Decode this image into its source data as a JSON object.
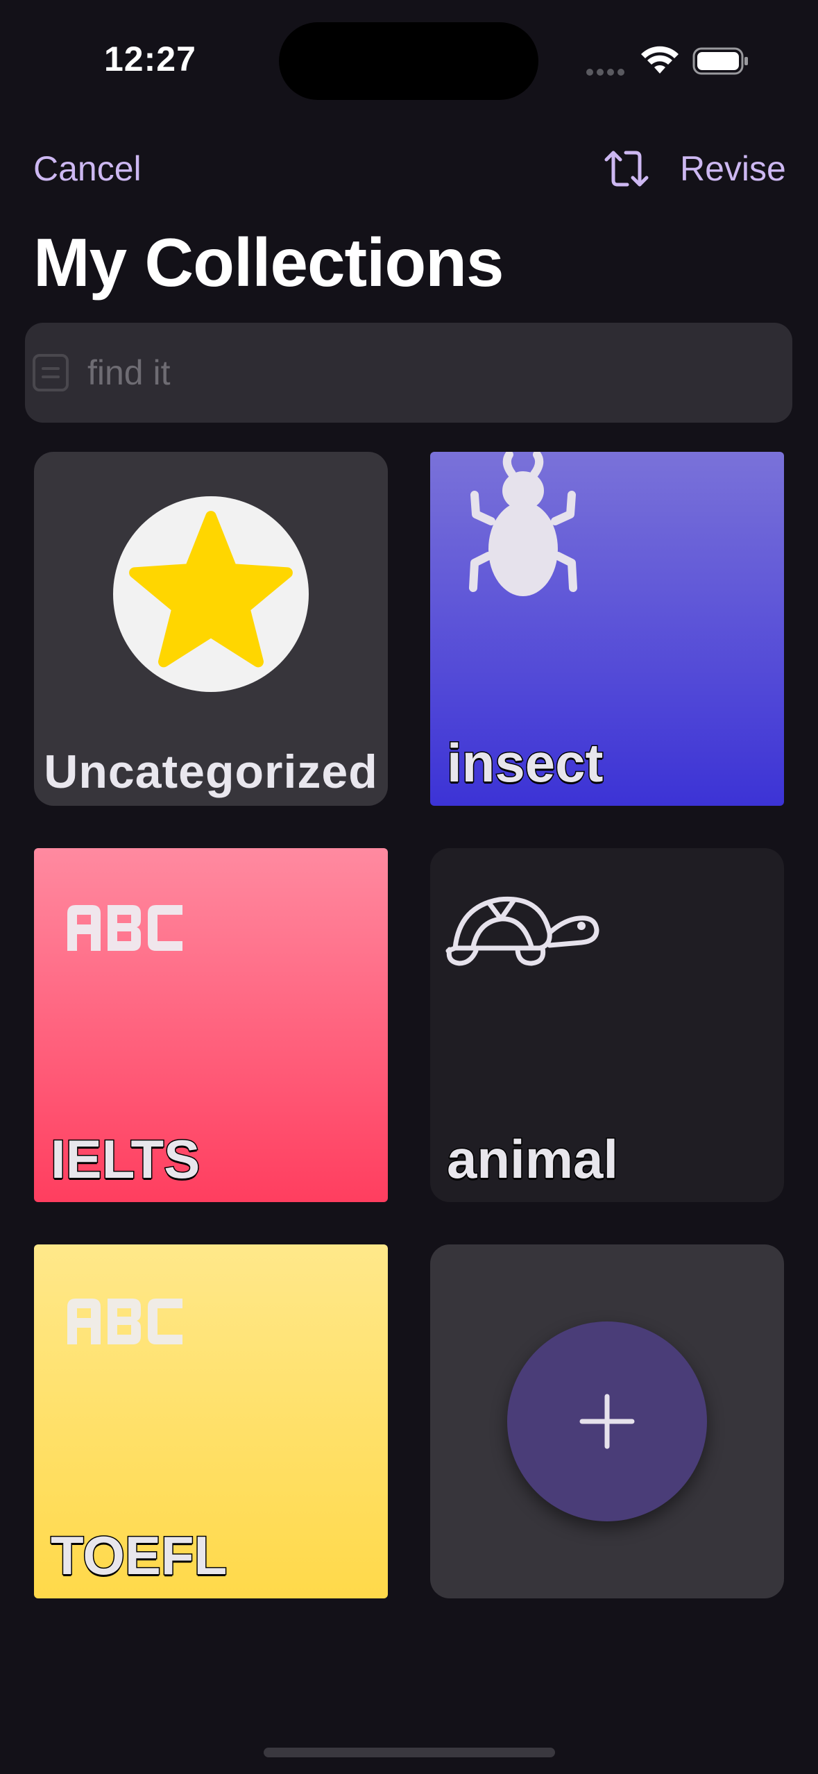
{
  "status_bar": {
    "time": "12:27"
  },
  "nav": {
    "cancel_label": "Cancel",
    "revise_label": "Revise"
  },
  "page": {
    "title": "My Collections"
  },
  "search": {
    "placeholder": "find it",
    "value": ""
  },
  "collections": [
    {
      "label": "Uncategorized",
      "icon": "star-icon",
      "background": "#37353b"
    },
    {
      "label": "insect",
      "icon": "insect-icon",
      "gradient": [
        "#7a72d9",
        "#3c33d6"
      ]
    },
    {
      "label": "IELTS",
      "icon": "abc-icon",
      "gradient": [
        "#ff8aa0",
        "#ff3e5f"
      ]
    },
    {
      "label": "animal",
      "icon": "turtle-icon",
      "background": "#1f1d23"
    },
    {
      "label": "TOEFL",
      "icon": "abc-icon",
      "gradient": [
        "#ffe88a",
        "#ffd94a"
      ]
    }
  ],
  "add_card": {
    "icon": "plus-icon",
    "color": "#4a3d78"
  },
  "colors": {
    "accent": "#cdb8f2",
    "background": "#131118",
    "star": "#ffd600"
  }
}
